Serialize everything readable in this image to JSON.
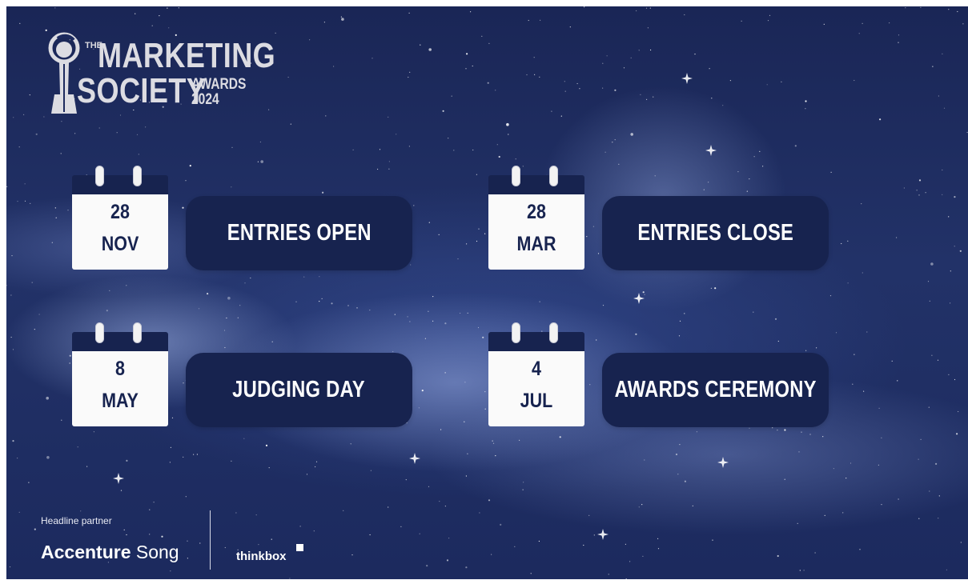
{
  "brand": {
    "the": "THE",
    "line1": "MARKETING",
    "line2": "SOCIETY",
    "awards": "AWARDS",
    "year": "2024"
  },
  "events": [
    {
      "day": "28",
      "month": "NOV",
      "label": "ENTRIES OPEN"
    },
    {
      "day": "28",
      "month": "MAR",
      "label": "ENTRIES CLOSE"
    },
    {
      "day": "8",
      "month": "MAY",
      "label": "JUDGING DAY"
    },
    {
      "day": "4",
      "month": "JUL",
      "label": "AWARDS CEREMONY"
    }
  ],
  "footer": {
    "headline_partner": "Headline partner",
    "accenture_bold": "Accenture",
    "accenture_light": "Song",
    "thinkbox": "thinkbox"
  },
  "colors": {
    "card_navy": "#17234f",
    "background_navy": "#1f2d63",
    "logo_silver": "#dcdce2"
  },
  "icons": [
    "calendar-icon",
    "trophy-logo-icon",
    "thinkbox-square-icon"
  ]
}
